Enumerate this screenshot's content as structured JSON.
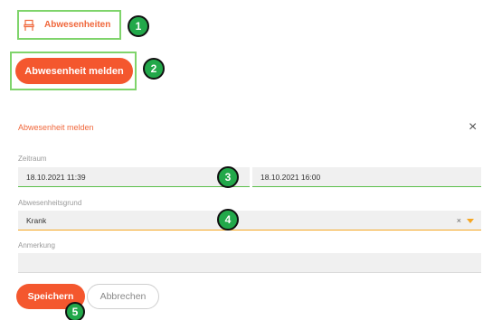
{
  "nav": {
    "absences_label": "Abwesenheiten"
  },
  "report_button": {
    "label": "Abwesenheit melden"
  },
  "dialog": {
    "title": "Abwesenheit melden",
    "close_symbol": "×",
    "period": {
      "label": "Zeitraum",
      "start": "18.10.2021 11:39",
      "end": "18.10.2021 16:00"
    },
    "reason": {
      "label": "Abwesenheitsgrund",
      "value": "Krank",
      "clear_symbol": "×"
    },
    "note": {
      "label": "Anmerkung",
      "value": ""
    },
    "save_label": "Speichern",
    "cancel_label": "Abbrechen"
  },
  "callouts": [
    "1",
    "2",
    "3",
    "4",
    "5"
  ],
  "colors": {
    "accent": "#f4572e",
    "highlight": "#7fd46b",
    "callout": "#22a84a",
    "focus": "#f5a623"
  },
  "icons": {
    "nav": "chair-icon",
    "dropdown": "caret-down-icon",
    "close": "close-icon"
  }
}
